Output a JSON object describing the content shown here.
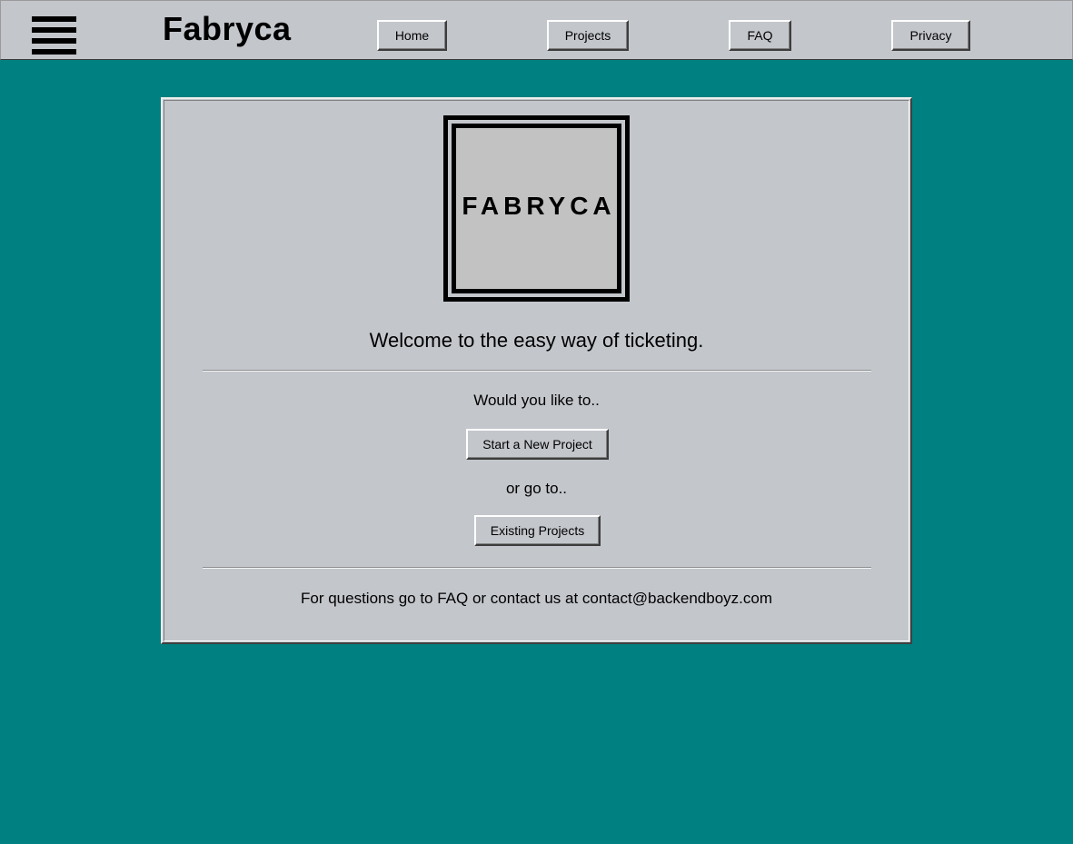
{
  "header": {
    "brand": "Fabryca",
    "nav": [
      "Home",
      "Projects",
      "FAQ",
      "Privacy"
    ],
    "menu_icon": "hamburger-menu-icon"
  },
  "main": {
    "logo_text": "FABRYCA",
    "welcome": "Welcome to the easy way of ticketing.",
    "prompt_1": "Would you like to..",
    "start_button": "Start a New Project",
    "prompt_2": "or go to..",
    "existing_button": "Existing Projects",
    "footer": "For questions go to FAQ or contact us at contact@backendboyz.com"
  },
  "colors": {
    "desktop": "#008080",
    "surface": "#c3c6cb",
    "text": "#000000"
  }
}
